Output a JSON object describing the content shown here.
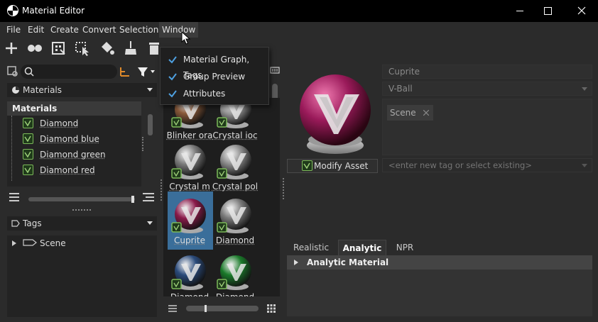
{
  "window": {
    "title": "Material Editor"
  },
  "menu": [
    "File",
    "Edit",
    "Create",
    "Convert",
    "Selection",
    "Window"
  ],
  "window_menu": {
    "items": [
      "Material Graph, Tags",
      "Group Preview",
      "Attributes"
    ]
  },
  "left": {
    "materials_dropdown": "Materials",
    "tree_header": "Materials",
    "tree_items": [
      "Diamond",
      "Diamond blue",
      "Diamond green",
      "Diamond red"
    ],
    "tags_dropdown": "Tags",
    "tags_items": [
      "Scene"
    ]
  },
  "grid": {
    "items": [
      {
        "label": "Blinker ora",
        "color": "#8a5a3a"
      },
      {
        "label": "Crystal ioc",
        "color": "#9a9a9a"
      },
      {
        "label": "Crystal m",
        "color": "#7a7a7a"
      },
      {
        "label": "Crystal pol",
        "color": "#8a8a8a"
      },
      {
        "label": "Cuprite",
        "color": "#8a1a4a"
      },
      {
        "label": "Diamond",
        "color": "#7a7a7a"
      },
      {
        "label": "Diamond",
        "color": "#2a4a7a"
      },
      {
        "label": "Diamond",
        "color": "#1a7a2a"
      }
    ]
  },
  "details": {
    "name": "Cuprite",
    "preview_type": "V-Ball",
    "tags": [
      "Scene"
    ],
    "modify_button": "Modify Asset",
    "tag_input_placeholder": "<enter new tag or select existing>",
    "tabs": [
      "Realistic",
      "Analytic",
      "NPR"
    ],
    "active_tab": "Analytic",
    "section": "Analytic Material"
  },
  "colors": {
    "accent_check": "#7dba5a",
    "selection": "#3a6e9a",
    "cuprite": "#9a1a5a"
  }
}
